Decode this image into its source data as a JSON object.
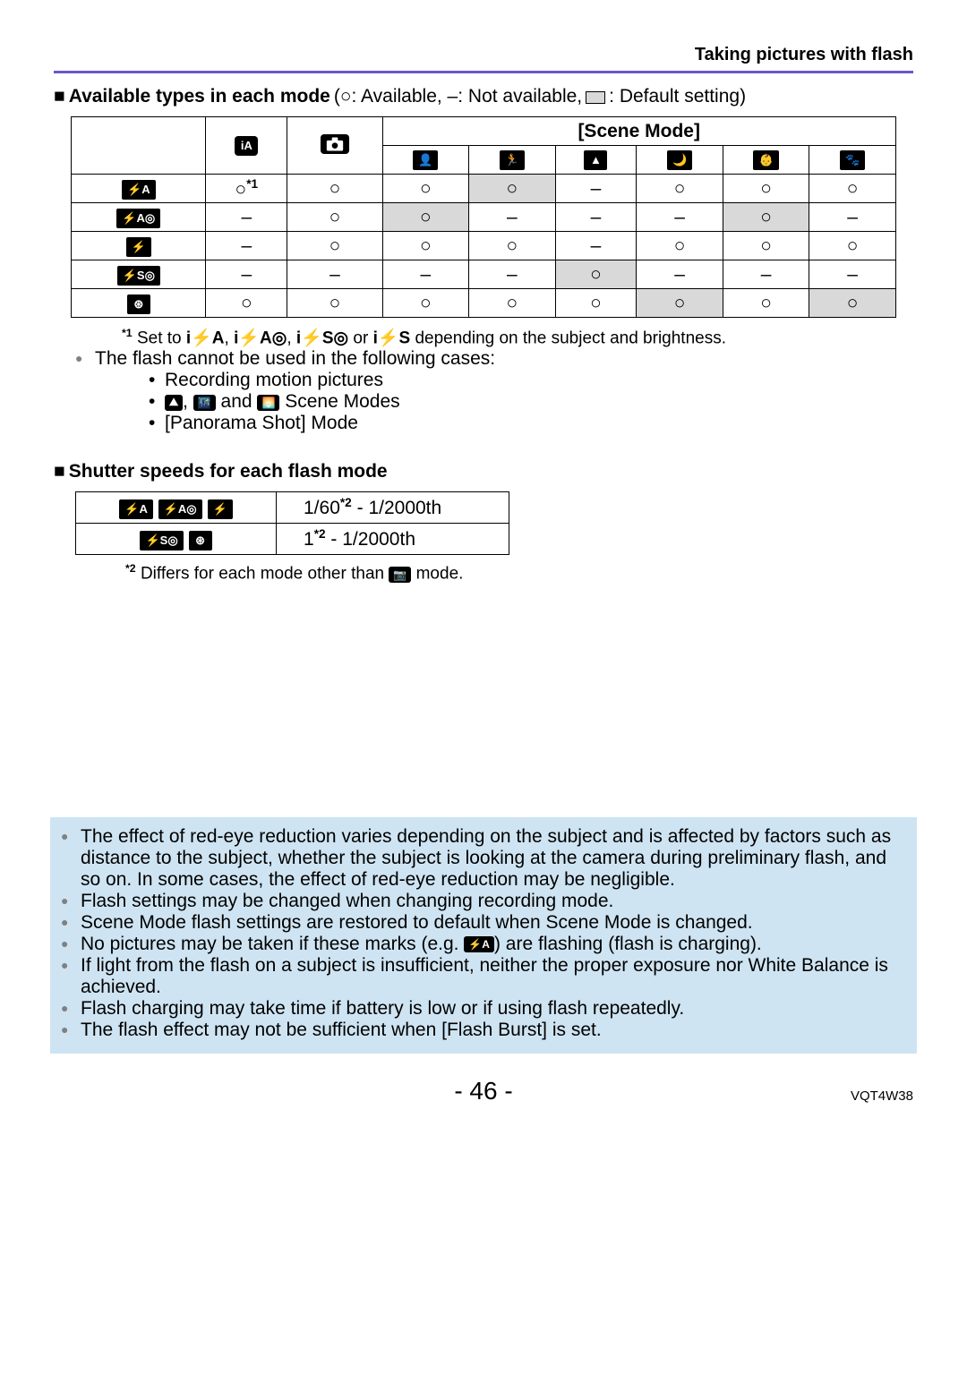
{
  "header": {
    "section": "Taking pictures with flash"
  },
  "h1": {
    "prefix": "■",
    "title": "Available types in each mode",
    "legend_available": "(○: Available, –: Not available,",
    "legend_default": ": Default setting)"
  },
  "modes_table": {
    "scene_mode_label": "[Scene Mode]",
    "col_icons": [
      "ia-mode",
      "camera-mode",
      "portrait",
      "sports",
      "landscape",
      "night-portrait",
      "baby",
      "pet"
    ],
    "rows": [
      {
        "icon": "flash-auto",
        "cells": [
          "○*1",
          "○",
          "○",
          "○_shade",
          "–",
          "○",
          "○",
          "○"
        ]
      },
      {
        "icon": "flash-auto-redeye",
        "cells": [
          "–",
          "○",
          "○_shade",
          "–",
          "–",
          "–",
          "○_shade",
          "–"
        ]
      },
      {
        "icon": "flash-forced",
        "cells": [
          "–",
          "○",
          "○",
          "○",
          "–",
          "○",
          "○",
          "○"
        ]
      },
      {
        "icon": "flash-slow-redeye",
        "cells": [
          "–",
          "–",
          "–",
          "–",
          "○_shade",
          "–",
          "–",
          "–"
        ]
      },
      {
        "icon": "flash-off",
        "cells": [
          "○",
          "○",
          "○",
          "○",
          "○",
          "○_shade",
          "○",
          "○_shade"
        ]
      }
    ]
  },
  "footnote1": {
    "marker": "*1",
    "before": " Set to ",
    "after": " depending on the subject and brightness."
  },
  "cannot": {
    "lead": "The flash cannot be used in the following cases:",
    "items": {
      "a": "Recording motion pictures",
      "b_after": " Scene Modes",
      "c": "[Panorama Shot] Mode"
    }
  },
  "h2b": {
    "prefix": "■",
    "title": "Shutter speeds for each flash mode"
  },
  "speed_table": {
    "rows": [
      {
        "icons": [
          "flash-auto",
          "flash-auto-redeye",
          "flash-forced"
        ],
        "val_pre": "1/60",
        "sup": "*2",
        "val_post": " - 1/2000th"
      },
      {
        "icons": [
          "flash-slow-redeye",
          "flash-off"
        ],
        "val_pre": "1",
        "sup": "*2",
        "val_post": " - 1/2000th"
      }
    ]
  },
  "footnote2": {
    "marker": "*2",
    "text_a": " Differs for each mode other than ",
    "text_b": " mode."
  },
  "box": {
    "items": {
      "a": "The effect of red-eye reduction varies depending on the subject and is affected by factors such as distance to the subject, whether the subject is looking at the camera during preliminary flash, and so on. In some cases, the effect of red-eye reduction may be negligible.",
      "b": "Flash settings may be changed when changing recording mode.",
      "c": "Scene Mode flash settings are restored to default when Scene Mode is changed.",
      "d_pre": "No pictures may be taken if these marks (e.g. ",
      "d_post": ") are flashing (flash is charging).",
      "e": "If light from the flash on a subject is insufficient, neither the proper exposure nor White Balance is achieved.",
      "f": "Flash charging may take time if battery is low or if using flash repeatedly.",
      "g": "The flash effect may not be sufficient when [Flash Burst] is set."
    }
  },
  "footer": {
    "page": "- 46 -",
    "doc": "VQT4W38"
  },
  "glyphs": {
    "flash-auto": "⚡A",
    "flash-auto-redeye": "⚡A◎",
    "flash-forced": "⚡",
    "flash-slow-redeye": "⚡S◎",
    "flash-off": "⊛",
    "ia-mode": "iA",
    "camera-mode": "📷",
    "portrait": "👤",
    "sports": "🏃",
    "landscape": "▲",
    "night-portrait": "🌙",
    "baby": "👶",
    "pet": "🐾",
    "scenery": "⛰",
    "night-scenery": "🌃",
    "sunset": "🌅",
    "i-flash-a": "i⚡A",
    "i-flash-a-re": "i⚡A◎",
    "i-flash-s-re": "i⚡S◎",
    "i-flash-s": "i⚡S"
  }
}
